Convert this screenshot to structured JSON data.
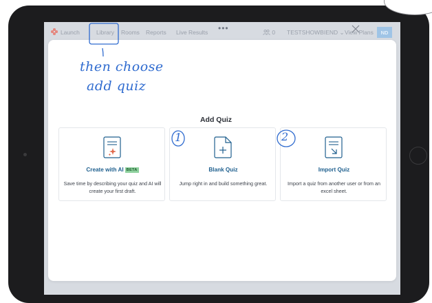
{
  "nav": {
    "items": [
      "Launch",
      "Library",
      "Rooms",
      "Reports",
      "Live Results"
    ],
    "more_glyph": "•••",
    "people_count": "0",
    "user_menu": "TESTSHOWBIEND ⌄",
    "view_plans": "View Plans",
    "avatar_initials": "ND"
  },
  "modal": {
    "title": "Add Quiz",
    "close_icon": "close-icon",
    "cards": [
      {
        "icon": "ai-sparkle-document-icon",
        "title": "Create with AI",
        "badge": "BETA",
        "description": "Save time by describing your quiz and AI will create your first draft."
      },
      {
        "icon": "blank-document-plus-icon",
        "title": "Blank Quiz",
        "description": "Jump right in and build something great."
      },
      {
        "icon": "import-document-arrow-icon",
        "title": "Import Quiz",
        "description": "Import a quiz from another user or from an excel sheet."
      }
    ]
  },
  "annotations": {
    "line1": "then choose",
    "line2": "add quiz",
    "marker1": "1",
    "marker2": "2"
  },
  "colors": {
    "accent": "#1e5f8e",
    "ink": "#2f6bcf",
    "beta_badge": "#8fd19e",
    "sparkle": "#e06a4c"
  }
}
